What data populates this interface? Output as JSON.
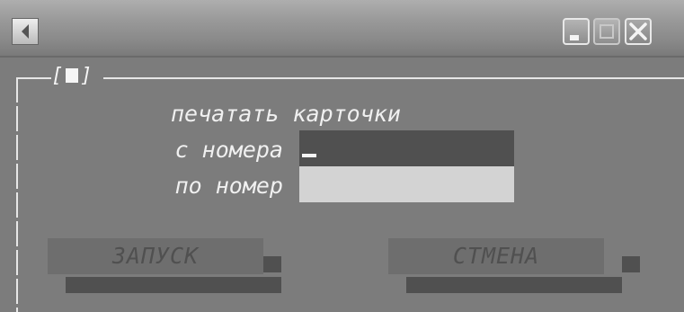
{
  "titlebar": {
    "app_icon": "app-menu-icon",
    "buttons": [
      {
        "icon": "minimize-icon"
      },
      {
        "icon": "maximize-icon"
      },
      {
        "icon": "close-icon"
      }
    ]
  },
  "dialog": {
    "frame_title_left": "[",
    "frame_title_right": "]",
    "heading": "печатать карточки",
    "from_label": "с номера",
    "to_label": "по номер",
    "from_value": "",
    "to_value": ""
  },
  "buttons": {
    "run_label": "ЗАПУСК",
    "cancel_label": "СТМЕНА"
  }
}
